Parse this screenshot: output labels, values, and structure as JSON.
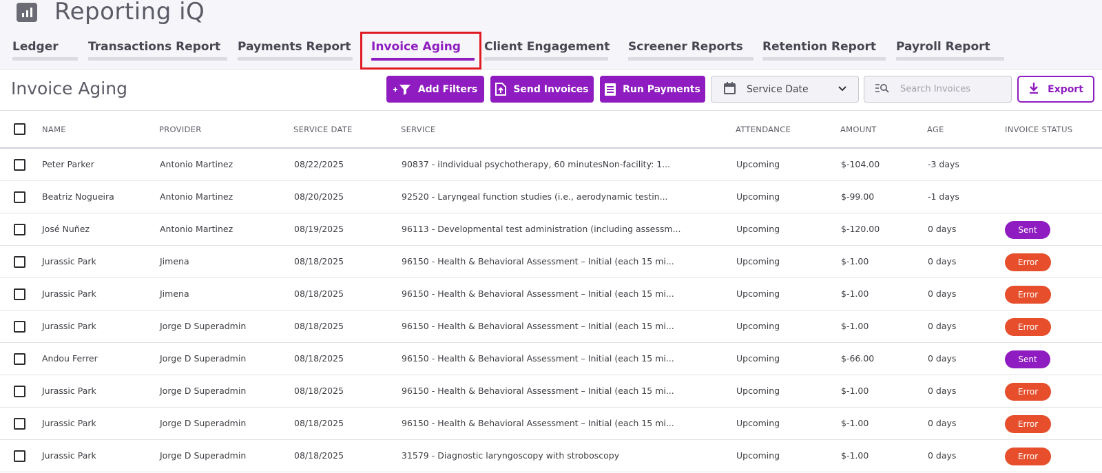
{
  "app": {
    "title": "Reporting iQ",
    "logo_icon": "bar-chart-icon"
  },
  "tabs": [
    {
      "label": "Ledger",
      "active": false
    },
    {
      "label": "Transactions Report",
      "active": false
    },
    {
      "label": "Payments Report",
      "active": false
    },
    {
      "label": "Invoice Aging",
      "active": true
    },
    {
      "label": "Client Engagement",
      "active": false
    },
    {
      "label": "Screener Reports",
      "active": false
    },
    {
      "label": "Retention Report",
      "active": false
    },
    {
      "label": "Payroll Report",
      "active": false
    }
  ],
  "page": {
    "title": "Invoice Aging"
  },
  "toolbar": {
    "add_filters": "Add Filters",
    "send_invoices": "Send Invoices",
    "run_payments": "Run Payments",
    "date_select": "Service Date",
    "search_placeholder": "Search Invoices",
    "export": "Export"
  },
  "table": {
    "columns": [
      "NAME",
      "PROVIDER",
      "SERVICE DATE",
      "SERVICE",
      "ATTENDANCE",
      "AMOUNT",
      "AGE",
      "INVOICE STATUS"
    ],
    "rows": [
      {
        "name": "Peter Parker",
        "provider": "Antonio Martinez",
        "service_date": "08/22/2025",
        "service": "90837 - iIndividual psychotherapy, 60 minutesNon-facility: 1...",
        "attendance": "Upcoming",
        "amount": "$-104.00",
        "age": "-3 days",
        "status": ""
      },
      {
        "name": "Beatriz Nogueira",
        "provider": "Antonio Martinez",
        "service_date": "08/20/2025",
        "service": "92520 - Laryngeal function studies (i.e., aerodynamic testin...",
        "attendance": "Upcoming",
        "amount": "$-99.00",
        "age": "-1 days",
        "status": ""
      },
      {
        "name": "José Nuñez",
        "provider": "Antonio Martinez",
        "service_date": "08/19/2025",
        "service": "96113 - Developmental test administration (including assessm...",
        "attendance": "Upcoming",
        "amount": "$-120.00",
        "age": "0 days",
        "status": "Sent"
      },
      {
        "name": "Jurassic Park",
        "provider": "Jimena",
        "service_date": "08/18/2025",
        "service": "96150 - Health & Behavioral Assessment – Initial (each 15 mi...",
        "attendance": "Upcoming",
        "amount": "$-1.00",
        "age": "0 days",
        "status": "Error"
      },
      {
        "name": "Jurassic Park",
        "provider": "Jimena",
        "service_date": "08/18/2025",
        "service": "96150 - Health & Behavioral Assessment – Initial (each 15 mi...",
        "attendance": "Upcoming",
        "amount": "$-1.00",
        "age": "0 days",
        "status": "Error"
      },
      {
        "name": "Jurassic Park",
        "provider": "Jorge D Superadmin",
        "service_date": "08/18/2025",
        "service": "96150 - Health & Behavioral Assessment – Initial (each 15 mi...",
        "attendance": "Upcoming",
        "amount": "$-1.00",
        "age": "0 days",
        "status": "Error"
      },
      {
        "name": "Andou Ferrer",
        "provider": "Jorge D Superadmin",
        "service_date": "08/18/2025",
        "service": "96150 - Health & Behavioral Assessment – Initial (each 15 mi...",
        "attendance": "Upcoming",
        "amount": "$-66.00",
        "age": "0 days",
        "status": "Sent"
      },
      {
        "name": "Jurassic Park",
        "provider": "Jorge D Superadmin",
        "service_date": "08/18/2025",
        "service": "96150 - Health & Behavioral Assessment – Initial (each 15 mi...",
        "attendance": "Upcoming",
        "amount": "$-1.00",
        "age": "0 days",
        "status": "Error"
      },
      {
        "name": "Jurassic Park",
        "provider": "Jorge D Superadmin",
        "service_date": "08/18/2025",
        "service": "96150 - Health & Behavioral Assessment – Initial (each 15 mi...",
        "attendance": "Upcoming",
        "amount": "$-1.00",
        "age": "0 days",
        "status": "Error"
      },
      {
        "name": "Jurassic Park",
        "provider": "Jorge D Superadmin",
        "service_date": "08/18/2025",
        "service": "31579 - Diagnostic laryngoscopy with stroboscopy",
        "attendance": "Upcoming",
        "amount": "$-1.00",
        "age": "0 days",
        "status": "Error"
      }
    ]
  },
  "colors": {
    "accent": "#8e1cc0",
    "error": "#e64e2c",
    "highlight": "#e11a22"
  }
}
